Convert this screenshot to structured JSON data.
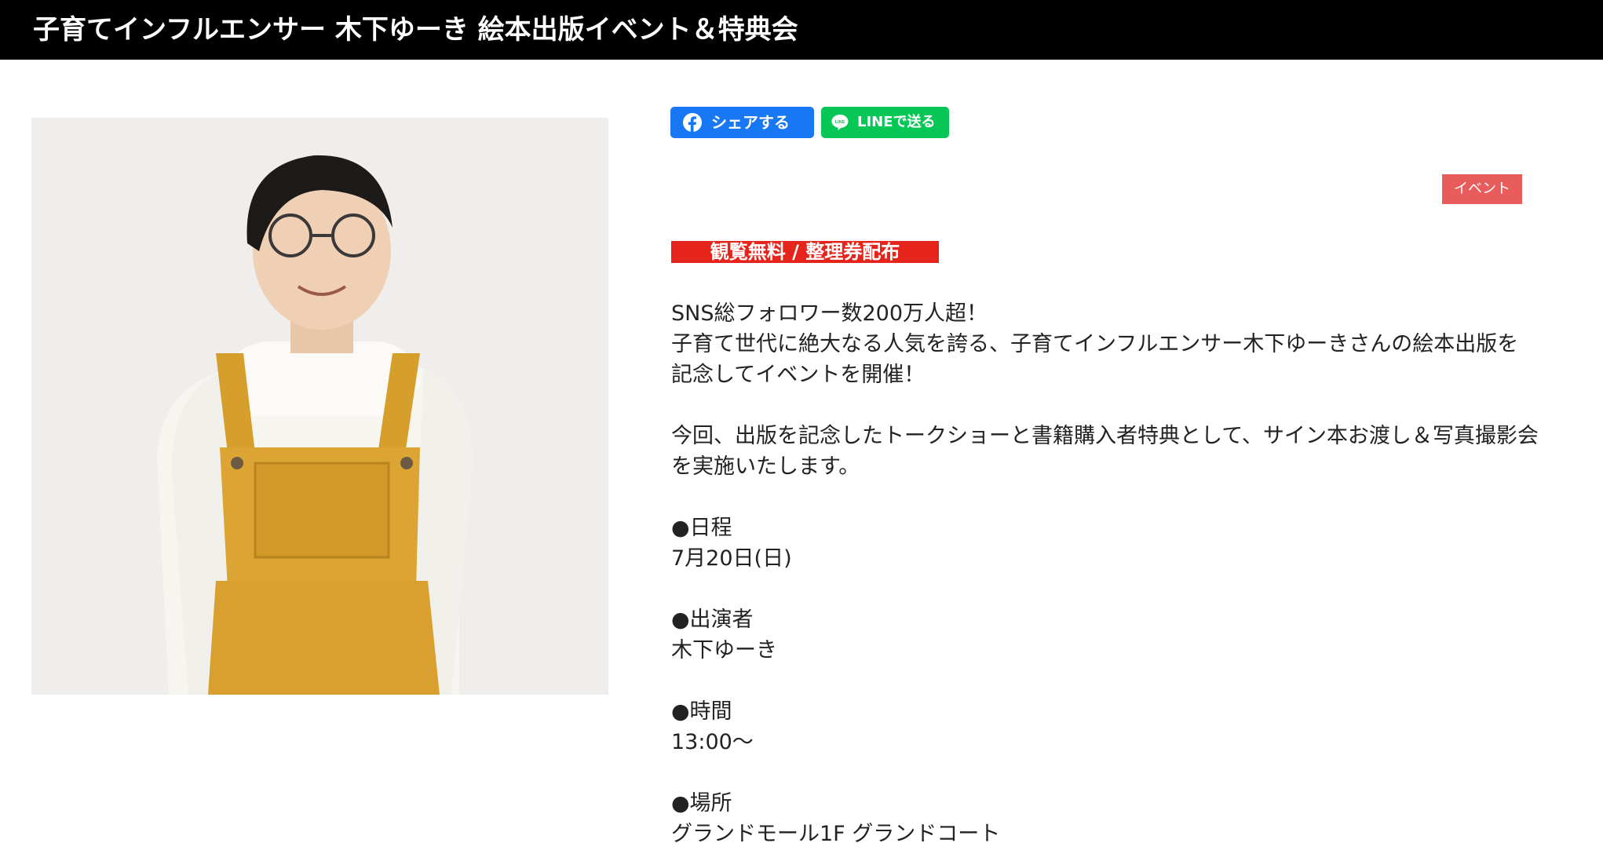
{
  "header": {
    "title": "子育てインフルエンサー 木下ゆーき 絵本出版イベント＆特典会"
  },
  "share": {
    "facebook_label": "シェアする",
    "facebook_icon": "facebook-icon",
    "line_label": "LINEで送る",
    "line_icon": "line-icon",
    "line_icon_text": "LINE"
  },
  "category_badge": "イベント",
  "highlight_label": "観覧無料 / 整理券配布",
  "intro": {
    "line1": "SNS総フォロワー数200万人超！",
    "line2": "子育て世代に絶大なる人気を誇る、子育てインフルエンサー木下ゆーきさんの絵本出版を",
    "line3": "記念してイベントを開催！",
    "line4": "今回、出版を記念したトークショーと書籍購入者特典として、サイン本お渡し＆写真撮影会",
    "line5": "を実施いたします。"
  },
  "details": [
    {
      "label": "●日程",
      "value": "7月20日(日)"
    },
    {
      "label": "●出演者",
      "value": "木下ゆーき"
    },
    {
      "label": "●時間",
      "value": "13:00〜"
    },
    {
      "label": "●場所",
      "value": "グランドモール1F グランドコート"
    }
  ],
  "colors": {
    "header_bg": "#000000",
    "facebook": "#1877f2",
    "line": "#06c755",
    "badge": "#e85c5c",
    "highlight": "#e5251b"
  }
}
